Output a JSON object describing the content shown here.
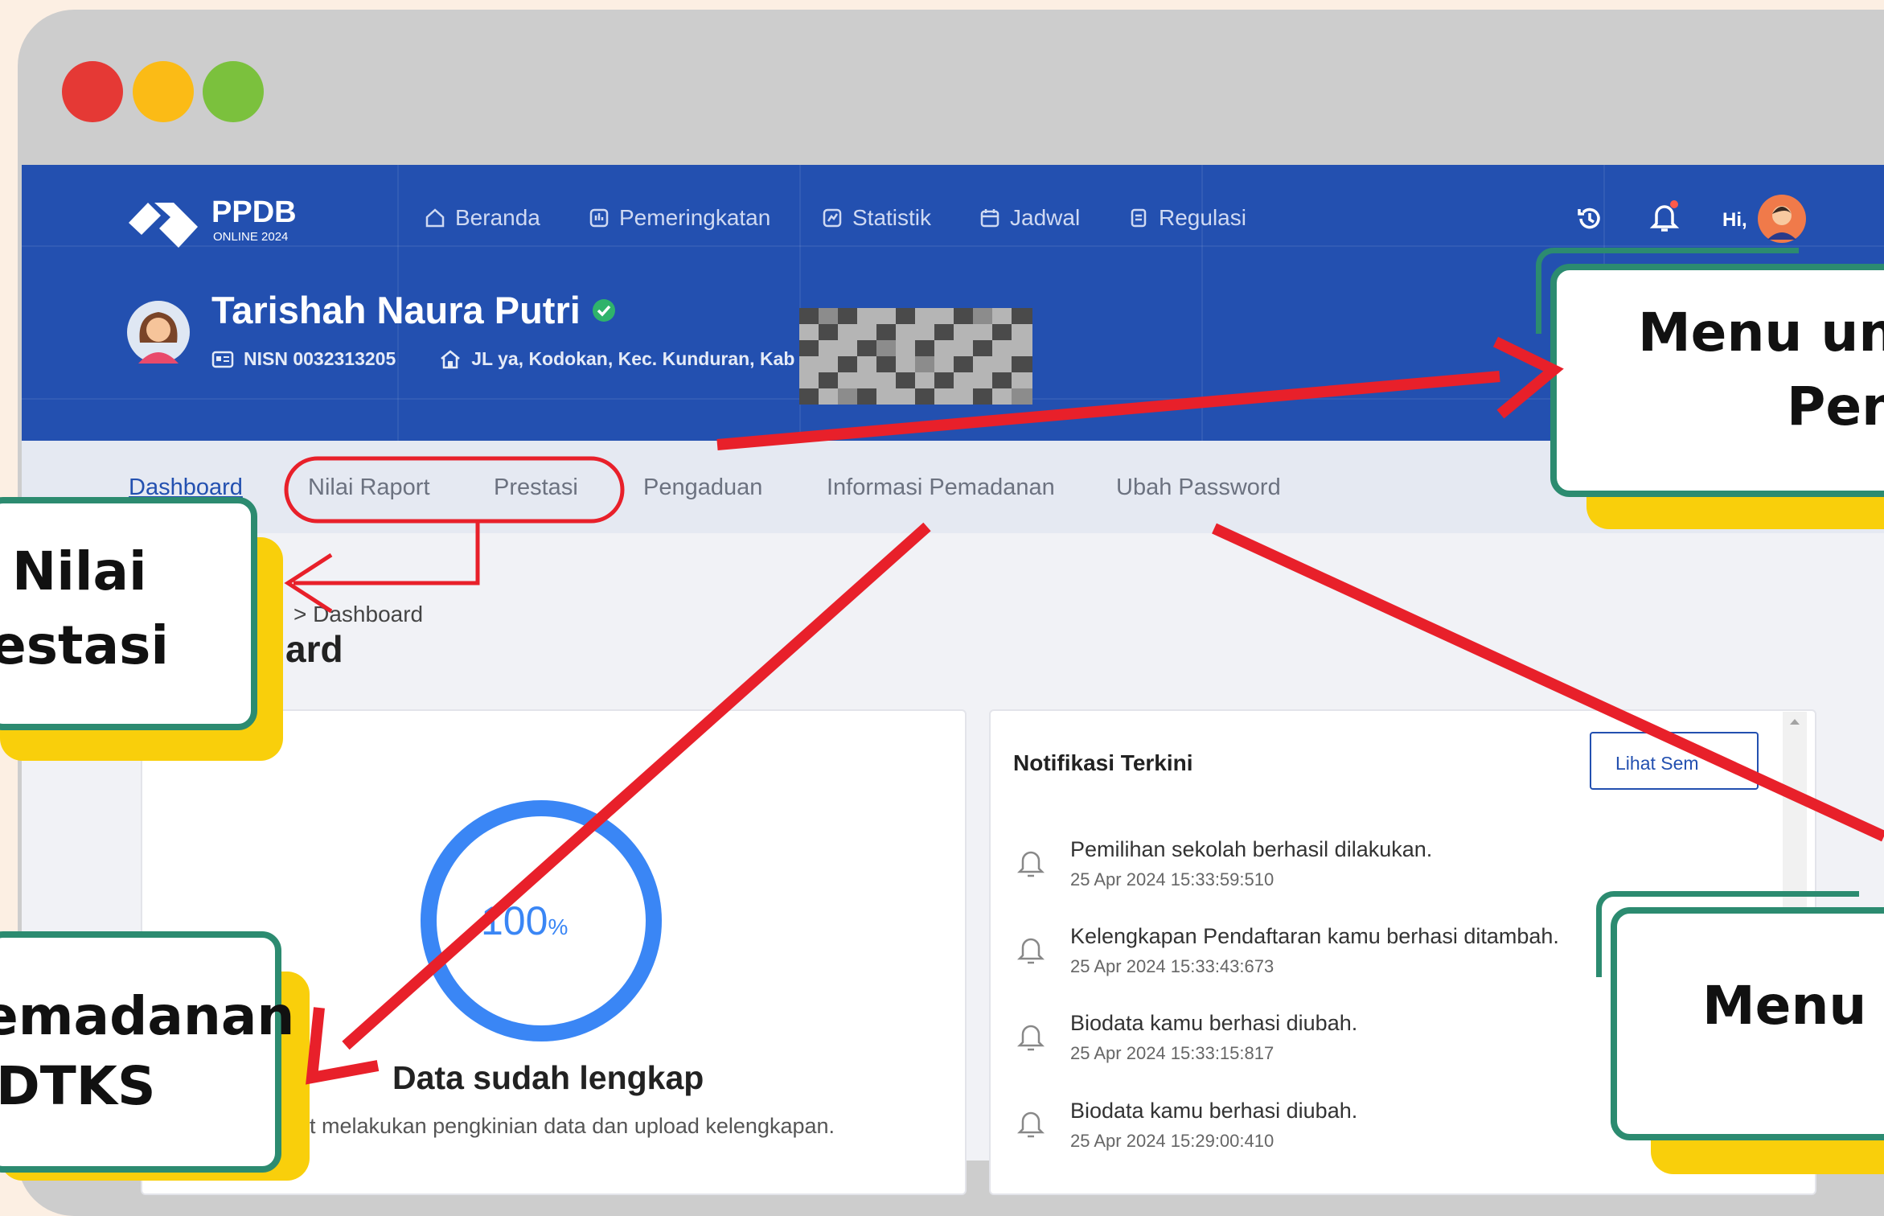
{
  "header": {
    "brand": "PPDB",
    "brand_sub": "ONLINE 2024",
    "nav": [
      {
        "label": "Beranda",
        "icon": "home-icon"
      },
      {
        "label": "Pemeringkatan",
        "icon": "ranking-icon"
      },
      {
        "label": "Statistik",
        "icon": "statistics-icon"
      },
      {
        "label": "Jadwal",
        "icon": "calendar-icon"
      },
      {
        "label": "Regulasi",
        "icon": "document-icon"
      }
    ],
    "greeting": "Hi,"
  },
  "profile": {
    "name": "Tarishah Naura Putri",
    "nisn": "NISN 0032313205",
    "address": "JL ya, Kodokan, Kec. Kunduran, Kab"
  },
  "tabs": [
    "Dashboard",
    "Nilai Raport",
    "Prestasi",
    "Pengaduan",
    "Informasi Pemadanan",
    "Ubah Password"
  ],
  "breadcrumb": "> Dashboard",
  "page_title": "ard",
  "progress": {
    "value": "100",
    "unit": "%",
    "fraction": 1.0,
    "title": "Data sudah lengkap",
    "desc": "pat melakukan pengkinian data dan upload kelengkapan."
  },
  "notifications": {
    "title": "Notifikasi Terkini",
    "see_all": "Lihat Sem",
    "items": [
      {
        "text": "Pemilihan sekolah berhasil dilakukan.",
        "time": "25 Apr 2024 15:33:59:510"
      },
      {
        "text": "Kelengkapan Pendaftaran kamu berhasi ditambah.",
        "time": "25 Apr 2024 15:33:43:673"
      },
      {
        "text": "Biodata kamu berhasi diubah.",
        "time": "25 Apr 2024 15:33:15:817"
      },
      {
        "text": "Biodata kamu berhasi diubah.",
        "time": "25 Apr 2024 15:29:00:410"
      }
    ]
  },
  "callouts": {
    "left_top": [
      "Nilai",
      "estasi"
    ],
    "left_bottom": [
      "emadanan",
      "DTKS"
    ],
    "right_top": [
      "Menu un",
      "Pen"
    ],
    "right_bottom": [
      "Menu U"
    ]
  },
  "colors": {
    "header_bg": "#2350b0",
    "accent_arrow": "#e8202a",
    "callout_border": "#2c8b70",
    "callout_shadow": "#f9cf0b",
    "progress": "#3a86f5"
  }
}
